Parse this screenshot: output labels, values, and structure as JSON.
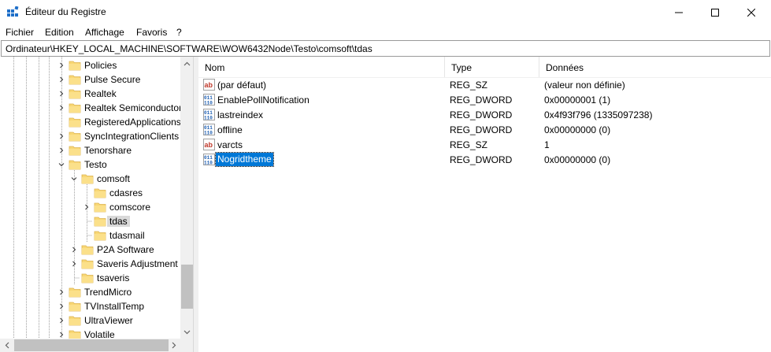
{
  "window": {
    "title": "Éditeur du Registre",
    "icon": "registry-editor-icon",
    "controls": [
      "minimize-icon",
      "maximize-icon",
      "close-icon"
    ]
  },
  "menu": [
    "Fichier",
    "Edition",
    "Affichage",
    "Favoris",
    "?"
  ],
  "address": "Ordinateur\\HKEY_LOCAL_MACHINE\\SOFTWARE\\WOW6432Node\\Testo\\comsoft\\tdas",
  "tree": [
    {
      "label": "Policies",
      "depth": 0,
      "expand": "collapsed"
    },
    {
      "label": "Pulse Secure",
      "depth": 0,
      "expand": "collapsed"
    },
    {
      "label": "Realtek",
      "depth": 0,
      "expand": "collapsed"
    },
    {
      "label": "Realtek Semiconductor",
      "depth": 0,
      "expand": "collapsed"
    },
    {
      "label": "RegisteredApplications",
      "depth": 0,
      "expand": "none"
    },
    {
      "label": "SyncIntegrationClients",
      "depth": 0,
      "expand": "collapsed"
    },
    {
      "label": "Tenorshare",
      "depth": 0,
      "expand": "collapsed"
    },
    {
      "label": "Testo",
      "depth": 0,
      "expand": "expanded"
    },
    {
      "label": "comsoft",
      "depth": 1,
      "expand": "expanded"
    },
    {
      "label": "cdasres",
      "depth": 2,
      "expand": "none"
    },
    {
      "label": "comscore",
      "depth": 2,
      "expand": "collapsed"
    },
    {
      "label": "tdas",
      "depth": 2,
      "expand": "none",
      "selected": true
    },
    {
      "label": "tdasmail",
      "depth": 2,
      "expand": "none"
    },
    {
      "label": "P2A Software",
      "depth": 1,
      "expand": "collapsed"
    },
    {
      "label": "Saveris Adjustment S",
      "depth": 1,
      "expand": "collapsed"
    },
    {
      "label": "tsaveris",
      "depth": 1,
      "expand": "none"
    },
    {
      "label": "TrendMicro",
      "depth": 0,
      "expand": "collapsed"
    },
    {
      "label": "TVInstallTemp",
      "depth": 0,
      "expand": "collapsed"
    },
    {
      "label": "UltraViewer",
      "depth": 0,
      "expand": "collapsed"
    },
    {
      "label": "Volatile",
      "depth": 0,
      "expand": "collapsed"
    }
  ],
  "columns": {
    "name": "Nom",
    "type": "Type",
    "data": "Données"
  },
  "values": [
    {
      "name": "(par défaut)",
      "type": "REG_SZ",
      "data": "(valeur non définie)",
      "icon": "string-value-icon"
    },
    {
      "name": "EnablePollNotification",
      "type": "REG_DWORD",
      "data": "0x00000001 (1)",
      "icon": "binary-value-icon"
    },
    {
      "name": "lastreindex",
      "type": "REG_DWORD",
      "data": "0x4f93f796 (1335097238)",
      "icon": "binary-value-icon"
    },
    {
      "name": "offline",
      "type": "REG_DWORD",
      "data": "0x00000000 (0)",
      "icon": "binary-value-icon"
    },
    {
      "name": "varcts",
      "type": "REG_SZ",
      "data": "1",
      "icon": "string-value-icon"
    },
    {
      "name": "Nogridtheme",
      "type": "REG_DWORD",
      "data": "0x00000000 (0)",
      "icon": "binary-value-icon",
      "selected": true
    }
  ],
  "colors": {
    "selection": "#0078d7",
    "folder": "#f8d775",
    "tree_selection": "#d9d9d9"
  }
}
